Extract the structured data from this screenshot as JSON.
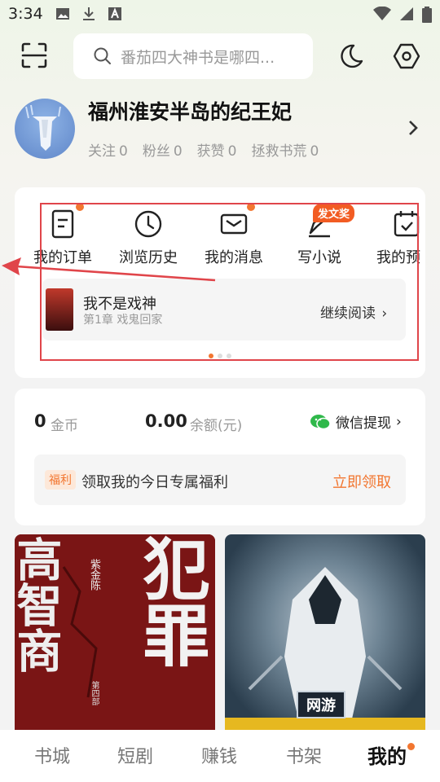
{
  "status_bar": {
    "time": "3:34",
    "left_icons": [
      "image-icon",
      "download-icon",
      "font-a-icon"
    ],
    "right_icons": [
      "wifi-icon",
      "signal-icon",
      "battery-icon"
    ]
  },
  "search": {
    "placeholder": "番茄四大神书是哪四..."
  },
  "profile": {
    "username": "福州淮安半岛的纪王妃",
    "stats": [
      {
        "label": "关注",
        "value": "0"
      },
      {
        "label": "粉丝",
        "value": "0"
      },
      {
        "label": "获赞",
        "value": "0"
      },
      {
        "label": "拯救书荒",
        "value": "0"
      }
    ]
  },
  "quick_actions": [
    {
      "label": "我的订单",
      "icon": "order-icon",
      "dot": true
    },
    {
      "label": "浏览历史",
      "icon": "clock-icon",
      "dot": false
    },
    {
      "label": "我的消息",
      "icon": "mail-icon",
      "dot": true
    },
    {
      "label": "写小说",
      "icon": "pen-icon",
      "badge": "发文奖"
    },
    {
      "label": "我的预",
      "icon": "calendar-check-icon",
      "dot": false
    }
  ],
  "reading": {
    "title": "我不是戏神",
    "chapter": "第1章 戏鬼回家",
    "continue_label": "继续阅读"
  },
  "wallet": {
    "coins_value": "0",
    "coins_label": "金币",
    "balance_value": "0.00",
    "balance_label": "余额(元)",
    "withdraw_label": "微信提现"
  },
  "welfare": {
    "tag": "福利",
    "text": "领取我的今日专属福利",
    "claim_label": "立即领取"
  },
  "books": [
    {
      "cover_text_main": "犯罪",
      "cover_text_side": "高智商",
      "author": "紫金陈",
      "volume": "第四部"
    },
    {
      "cover_text_main": "网游"
    }
  ],
  "bottom_nav": [
    {
      "label": "书城"
    },
    {
      "label": "短剧"
    },
    {
      "label": "赚钱"
    },
    {
      "label": "书架"
    },
    {
      "label": "我的",
      "active": true
    }
  ],
  "colors": {
    "accent": "#f27630",
    "annotation": "#e0454a",
    "wechat": "#2fb84a"
  }
}
